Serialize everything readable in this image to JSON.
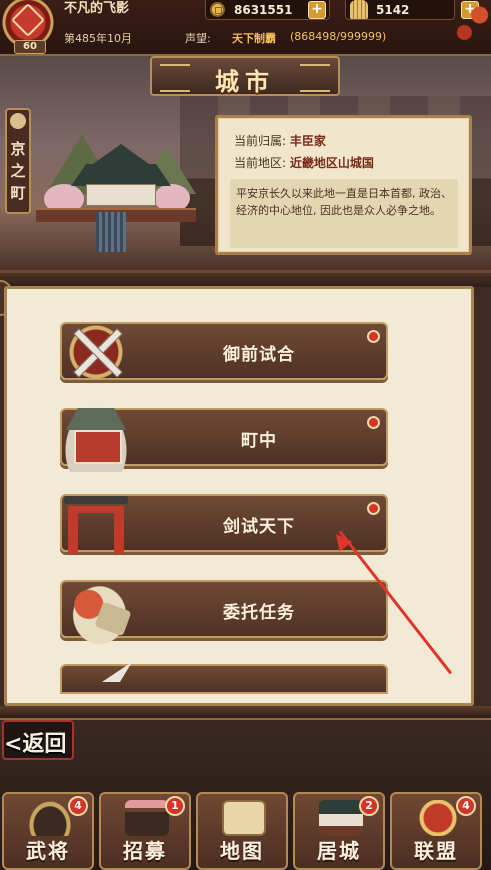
{
  "header": {
    "player_name": "不凡的飞影",
    "level": "60",
    "coins": "8631551",
    "fans": "5142",
    "date": "第485年10月",
    "fame_label": "声望:",
    "fame_title": "天下制霸",
    "fame_value": "(868498/999999)"
  },
  "city": {
    "title": "城市",
    "name_vertical": "京之町",
    "owner_label": "当前归属:",
    "owner_value": "丰臣家",
    "region_label": "当前地区:",
    "region_value": "近畿地区山城国",
    "description": "平安京长久以来此地一直是日本首都, 政治、经济的中心地位, 因此也是众人必争之地。"
  },
  "menu": [
    {
      "label": "御前试合",
      "has_dot": true
    },
    {
      "label": "町中",
      "has_dot": true
    },
    {
      "label": "剑试天下",
      "has_dot": true
    },
    {
      "label": "委托任务",
      "has_dot": false
    }
  ],
  "back_label": "<返回",
  "nav": [
    {
      "label": "武将",
      "badge": "4"
    },
    {
      "label": "招募",
      "badge": "1"
    },
    {
      "label": "地图",
      "badge": ""
    },
    {
      "label": "居城",
      "badge": "2"
    },
    {
      "label": "联盟",
      "badge": "4"
    }
  ],
  "colors": {
    "accent_red": "#d6332a",
    "gold": "#c09b62",
    "panel_bg": "#f3ead6",
    "annotation_arrow": "#e0352b"
  }
}
